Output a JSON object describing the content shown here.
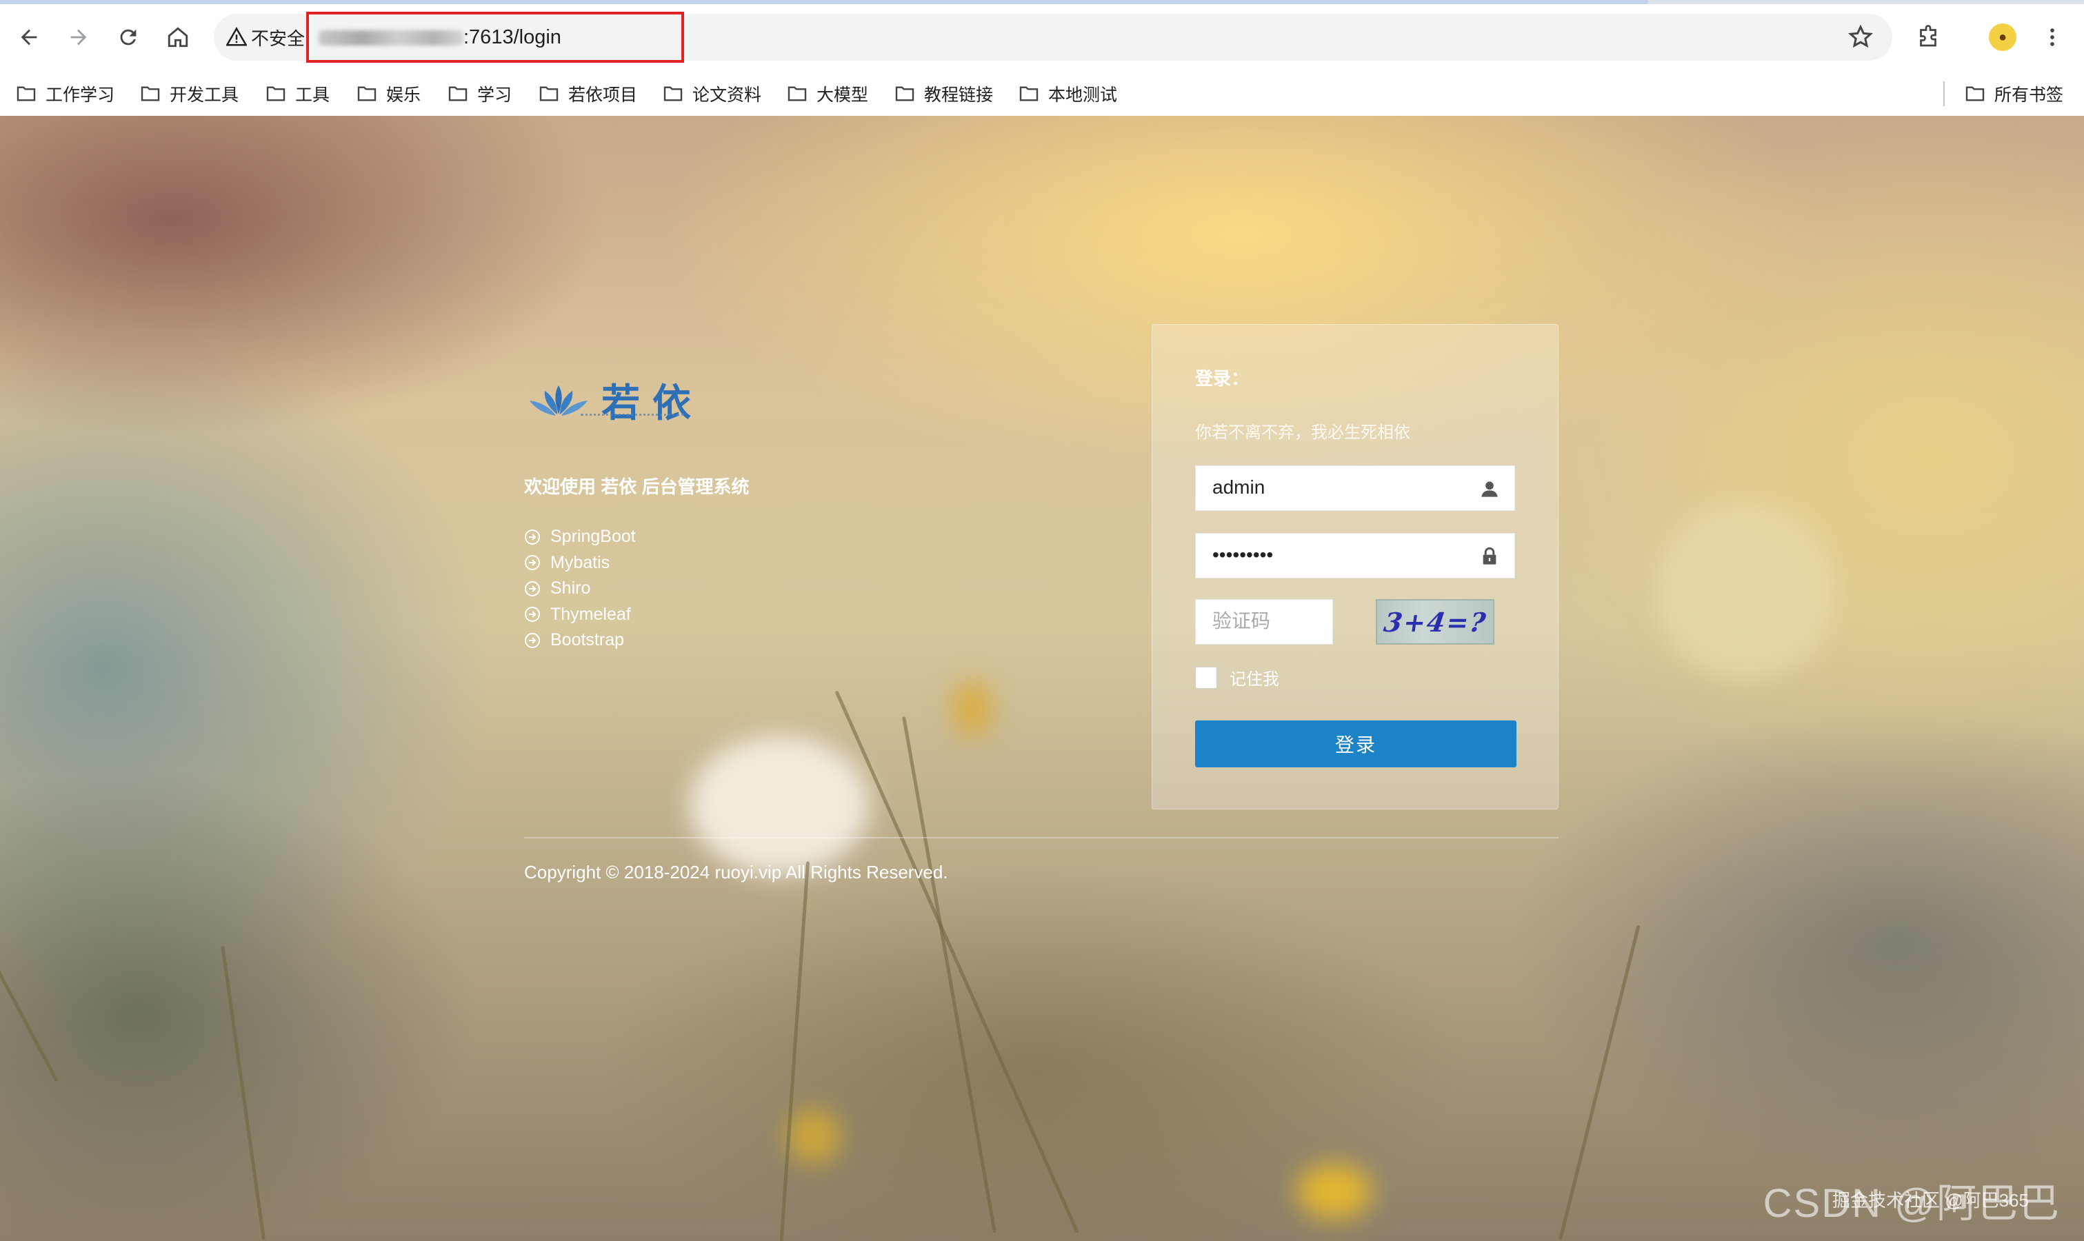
{
  "browser": {
    "security_label": "不安全",
    "url": ":7613/login",
    "bookmarks": [
      "工作学习",
      "开发工具",
      "工具",
      "娱乐",
      "学习",
      "若依项目",
      "论文资料",
      "大模型",
      "教程链接",
      "本地测试"
    ],
    "all_bookmarks": "所有书签"
  },
  "brand": {
    "logo_text": "若依",
    "welcome": "欢迎使用 若依 后台管理系统",
    "tech": [
      "SpringBoot",
      "Mybatis",
      "Shiro",
      "Thymeleaf",
      "Bootstrap"
    ]
  },
  "login": {
    "title": "登录：",
    "subtitle": "你若不离不弃，我必生死相依",
    "username": "admin",
    "password": "•••••••••",
    "captcha_placeholder": "验证码",
    "captcha_text": "3+4=?",
    "remember": "记住我",
    "submit": "登录"
  },
  "footer": {
    "copyright": "Copyright © 2018-2024 ruoyi.vip All Rights Reserved."
  },
  "watermark": {
    "main": "CSDN @阿巴巴",
    "secondary": "掘金技术社区 @阿巴365"
  },
  "colors": {
    "primary_button": "#1c84c6",
    "logo_blue": "#2f6fb5",
    "url_highlight_box": "#e02424"
  }
}
